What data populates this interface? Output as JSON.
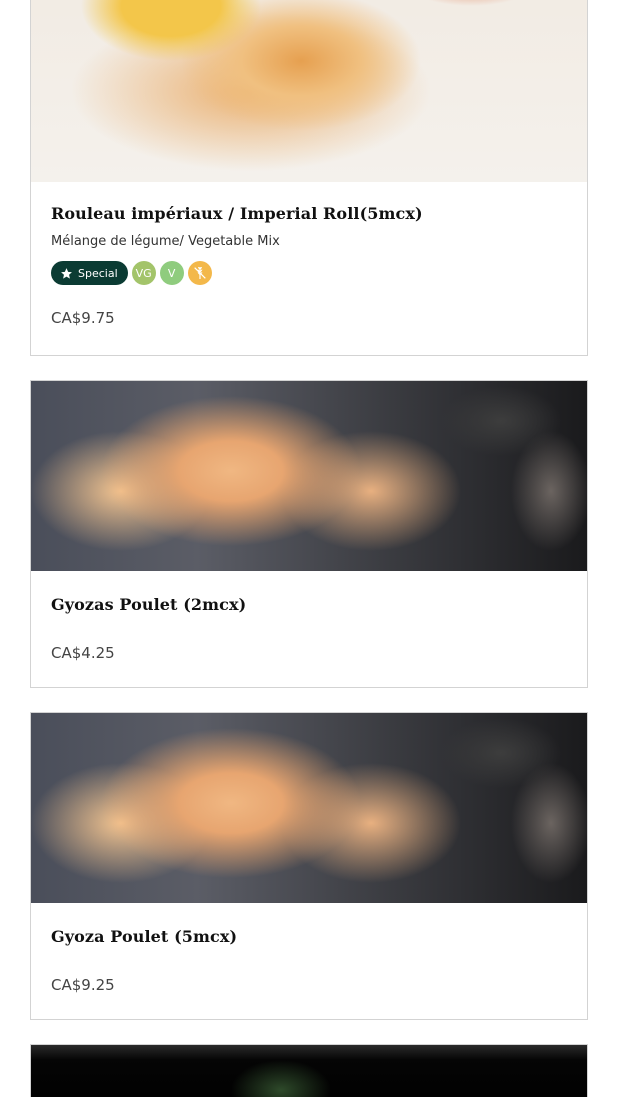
{
  "menu_items": [
    {
      "title": "Rouleau impériaux / Imperial Roll(5mcx)",
      "description": "Mélange de légume/ Vegetable Mix",
      "badges": {
        "special_label": "Special",
        "vegan_label": "VG",
        "vegetarian_label": "V",
        "gluten_free_icon": "wheat-crossed-icon"
      },
      "price": "CA$9.75",
      "image_icon": "imperial-roll-photo"
    },
    {
      "title": "Gyozas Poulet (2mcx)",
      "price": "CA$4.25",
      "image_icon": "gyoza-photo"
    },
    {
      "title": "Gyoza Poulet (5mcx)",
      "price": "CA$9.25",
      "image_icon": "gyoza-photo"
    },
    {
      "image_icon": "dark-dish-photo"
    }
  ],
  "colors": {
    "special_badge": "#0b3b33",
    "vegan_badge": "#a3c46a",
    "vegetarian_badge": "#8fcc7e",
    "gluten_free_badge": "#f3b84a",
    "card_border": "#d3d3d3"
  }
}
